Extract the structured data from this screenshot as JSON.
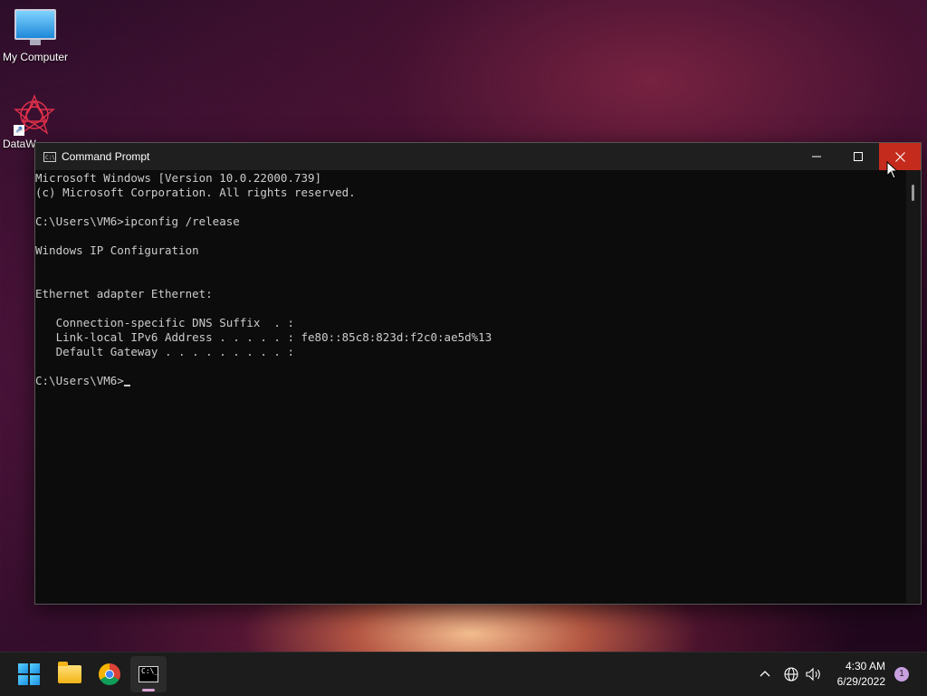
{
  "desktop": {
    "icons": [
      {
        "label": "My Computer",
        "icon": "monitor-icon"
      },
      {
        "label": "DataW",
        "icon": "datawrapper-icon"
      }
    ]
  },
  "window": {
    "title": "Command Prompt",
    "controls": {
      "minimize": "─",
      "maximize": "☐",
      "close": "✕"
    },
    "console_lines": [
      "Microsoft Windows [Version 10.0.22000.739]",
      "(c) Microsoft Corporation. All rights reserved.",
      "",
      "C:\\Users\\VM6>ipconfig /release",
      "",
      "Windows IP Configuration",
      "",
      "",
      "Ethernet adapter Ethernet:",
      "",
      "   Connection-specific DNS Suffix  . :",
      "   Link-local IPv6 Address . . . . . : fe80::85c8:823d:f2c0:ae5d%13",
      "   Default Gateway . . . . . . . . . :",
      ""
    ],
    "prompt": "C:\\Users\\VM6>"
  },
  "taskbar": {
    "apps": [
      "start-icon",
      "file-explorer-icon",
      "chrome-icon",
      "command-prompt-icon"
    ],
    "tray": {
      "chevron": "^",
      "network_icon": "globe-icon",
      "volume_icon": "speaker-icon"
    },
    "time": "4:30 AM",
    "date": "6/29/2022",
    "notification_count": "1"
  },
  "colors": {
    "close_button": "#c42b1c",
    "console_bg": "#0c0c0c",
    "console_text": "#cccccc",
    "taskbar_bg": "#1c1c1c"
  }
}
